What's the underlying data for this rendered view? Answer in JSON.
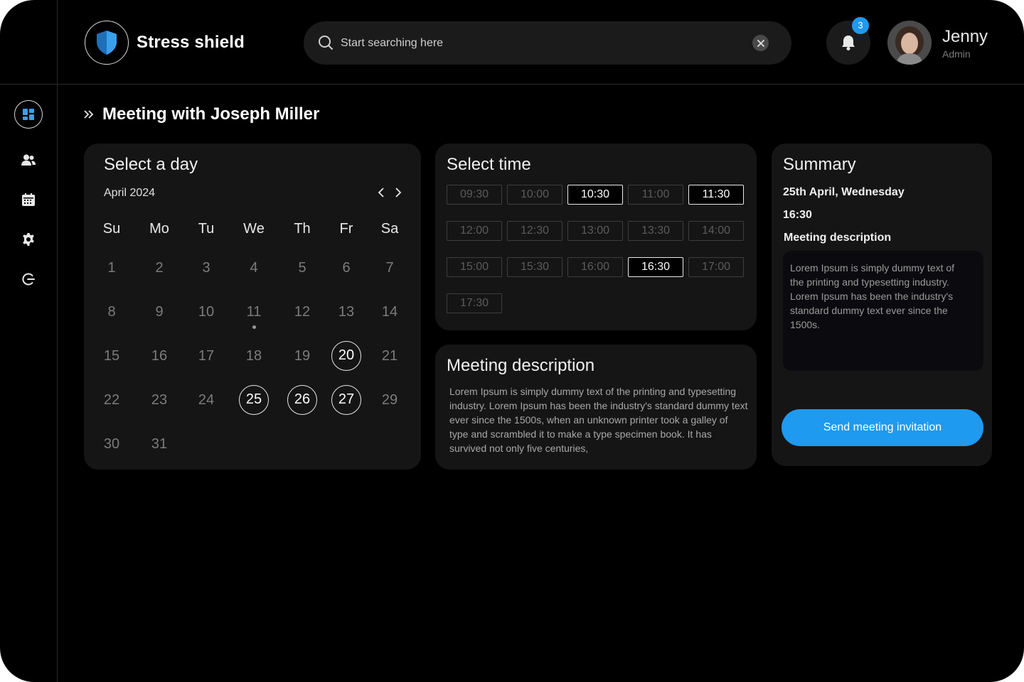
{
  "app": {
    "title": "Stress shield"
  },
  "search": {
    "placeholder": "Start searching here"
  },
  "notifications": {
    "count": "3"
  },
  "user": {
    "name": "Jenny",
    "role": "Admin"
  },
  "sidebar": {
    "items": [
      {
        "icon": "dashboard-icon",
        "active": true
      },
      {
        "icon": "users-icon",
        "active": false
      },
      {
        "icon": "calendar-icon",
        "active": false
      },
      {
        "icon": "gear-icon",
        "active": false
      },
      {
        "icon": "logout-icon",
        "active": false
      }
    ]
  },
  "page": {
    "title": "Meeting with Joseph Miller"
  },
  "calendar": {
    "title": "Select a day",
    "month": "April 2024",
    "weekdays": [
      "Su",
      "Mo",
      "Tu",
      "We",
      "Th",
      "Fr",
      "Sa"
    ],
    "weeks": [
      [
        "1",
        "2",
        "3",
        "4",
        "5",
        "6",
        "7"
      ],
      [
        "8",
        "9",
        "10",
        "11",
        "12",
        "13",
        "14"
      ],
      [
        "15",
        "16",
        "17",
        "18",
        "19",
        "20",
        "21"
      ],
      [
        "22",
        "23",
        "24",
        "25",
        "26",
        "27",
        "29"
      ],
      [
        "30",
        "31"
      ]
    ],
    "selected_days": [
      "20",
      "25",
      "26",
      "27"
    ],
    "marked_days": [
      "11"
    ]
  },
  "times": {
    "title": "Select time",
    "slots": [
      "09:30",
      "10:00",
      "10:30",
      "11:00",
      "11:30",
      "12:00",
      "12:30",
      "13:00",
      "13:30",
      "14:00",
      "15:00",
      "15:30",
      "16:00",
      "16:30",
      "17:00",
      "17:30"
    ],
    "active": [
      "10:30",
      "11:30",
      "16:30"
    ]
  },
  "description": {
    "title": "Meeting description",
    "text": "Lorem Ipsum is simply dummy text of the printing and typesetting industry. Lorem Ipsum has been the industry's standard dummy text ever since the 1500s, when an unknown printer took a galley of type and scrambled it to make a type specimen book. It has survived not only five centuries,"
  },
  "summary": {
    "title": "Summary",
    "date": "25th April, Wednesday",
    "time": "16:30",
    "desc_label": "Meeting description",
    "desc_text": "Lorem Ipsum is simply dummy text of the printing and typesetting industry. Lorem Ipsum has been the industry's standard dummy text ever since the 1500s.",
    "button": "Send meeting invitation"
  },
  "colors": {
    "accent": "#1e9af0",
    "background": "#000000",
    "card": "#151515"
  }
}
